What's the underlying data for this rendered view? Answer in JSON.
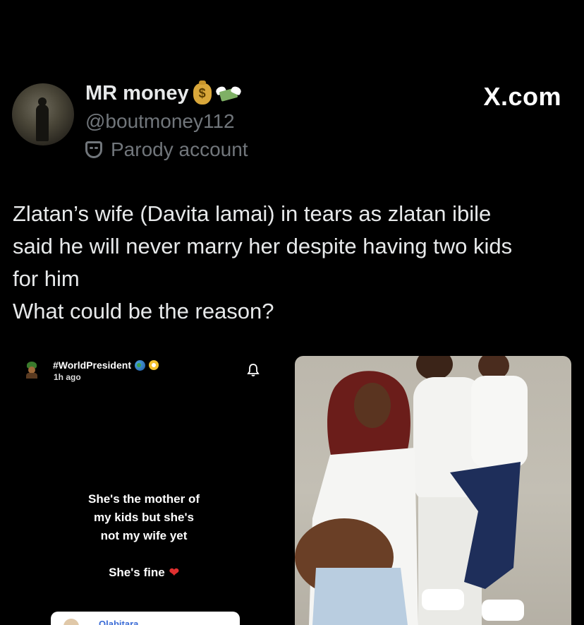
{
  "post": {
    "display_name": "MR money",
    "name_emojis": [
      "money-bag-icon",
      "money-with-wings-icon"
    ],
    "money_bag_glyph": "$",
    "handle": "@boutmoney112",
    "label": "Parody account",
    "watermark": "X.com",
    "text_lines": [
      "Zlatan’s wife (Davita lamai) in tears as zlatan ibile",
      "said he will never marry her despite having two kids",
      "for him",
      "What could be the reason?"
    ]
  },
  "story": {
    "name": "#WorldPresident",
    "time": "1h ago",
    "lines": [
      "She's the mother of",
      "my kids but she's",
      "not my wife yet"
    ],
    "fine_text": "She's fine",
    "reply_name": "Olabitara"
  },
  "colors": {
    "background": "#000000",
    "text": "#e7e9ea",
    "muted": "#71767b",
    "heart": "#e03030"
  }
}
